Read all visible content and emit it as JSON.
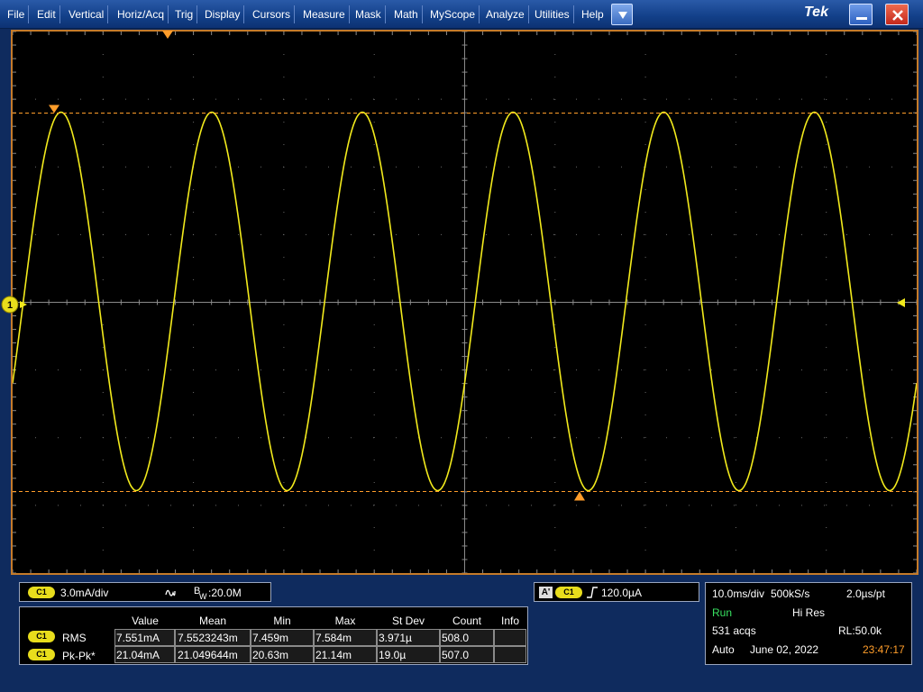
{
  "menu": {
    "items": [
      "File",
      "Edit",
      "Vertical",
      "Horiz/Acq",
      "Trig",
      "Display",
      "Cursors",
      "Measure",
      "Mask",
      "Math",
      "MyScope",
      "Analyze",
      "Utilities",
      "Help"
    ],
    "brand": "Tek",
    "dropdown_icon": "chevron-down-icon",
    "minimize_icon": "minimize-icon",
    "close_icon": "close-icon"
  },
  "display": {
    "channel_marker": "1",
    "trace_color": "#f2ea1c",
    "grid_color": "#6b6b6b",
    "cursor_color": "#ff9d2a",
    "frame_color": "#c57b2a",
    "background": "#000000"
  },
  "vertical": {
    "channel_badge": "C1",
    "scale": "3.0mA/div",
    "bandwidth_prefix": "B",
    "bandwidth_sub": "W",
    "bandwidth_value": ":20.0M"
  },
  "trigger": {
    "source_badge": "A'",
    "channel_badge": "C1",
    "level": "120.0µA"
  },
  "horizontal": {
    "scale": "10.0ms/div",
    "sample_rate": "500kS/s",
    "resolution": "2.0µs/pt",
    "state": "Run",
    "acq_mode": "Hi Res",
    "acquisitions": "531 acqs",
    "record_length": "RL:50.0k",
    "trigger_mode": "Auto",
    "date": "June 02, 2022",
    "time": "23:47:17"
  },
  "measurements": {
    "headers": [
      "Value",
      "Mean",
      "Min",
      "Max",
      "St Dev",
      "Count",
      "Info"
    ],
    "rows": [
      {
        "badge": "C1",
        "name": "RMS",
        "value": "7.551mA",
        "mean": "7.5523243m",
        "min": "7.459m",
        "max": "7.584m",
        "stdev": "3.971µ",
        "count": "508.0",
        "info": ""
      },
      {
        "badge": "C1",
        "name": "Pk-Pk*",
        "value": "21.04mA",
        "mean": "21.049644m",
        "min": "20.63m",
        "max": "21.14m",
        "stdev": "19.0µ",
        "count": "507.0",
        "info": ""
      }
    ]
  },
  "waveform": {
    "type": "sine",
    "cycles_visible": 6,
    "samples": 20
  }
}
